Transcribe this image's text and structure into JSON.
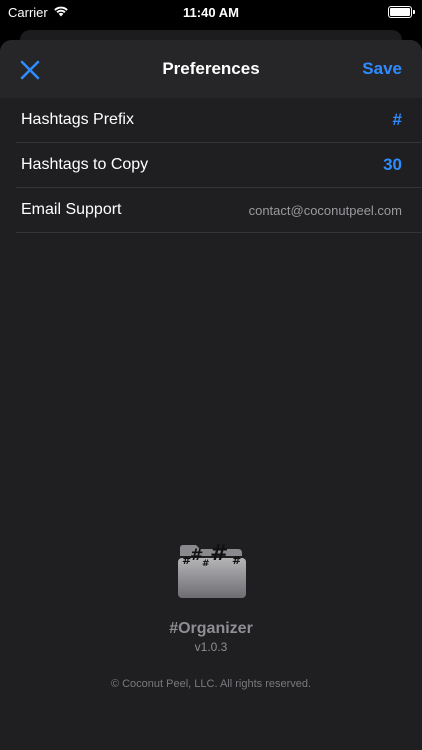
{
  "status_bar": {
    "carrier": "Carrier",
    "time": "11:40 AM",
    "wifi_icon": "wifi-icon",
    "battery_icon": "battery-icon"
  },
  "nav": {
    "title": "Preferences",
    "close_icon": "close-icon",
    "save_label": "Save"
  },
  "settings": [
    {
      "label": "Hashtags Prefix",
      "value": "#"
    },
    {
      "label": "Hashtags to Copy",
      "value": "30"
    },
    {
      "label": "Email Support",
      "value": "contact@coconutpeel.com"
    }
  ],
  "footer": {
    "logo_icon": "hashtag-folder-icon",
    "app_name": "#Organizer",
    "version": "v1.0.3",
    "copyright": "© Coconut Peel, LLC. All rights reserved."
  },
  "colors": {
    "accent": "#2f8cff",
    "background": "#1f1f21",
    "nav_background": "#262628"
  }
}
